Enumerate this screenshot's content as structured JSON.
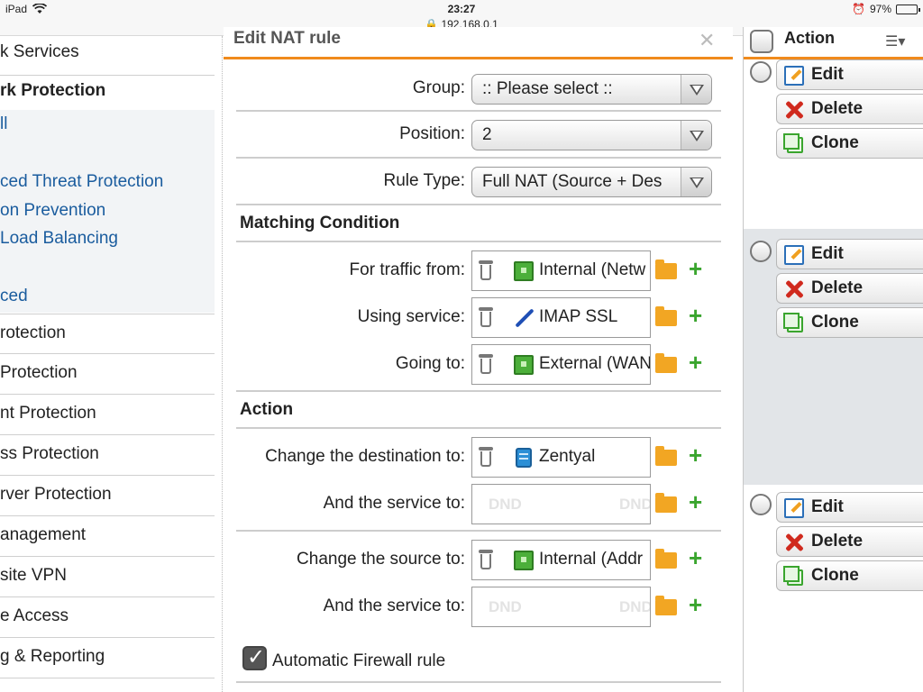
{
  "status_bar": {
    "device": "iPad",
    "time": "23:27",
    "url": "192.168.0.1",
    "battery": "97%",
    "battery_level": 0.97
  },
  "sidebar": {
    "items": [
      {
        "label": "k Services",
        "kind": "plain"
      },
      {
        "label": "rk Protection",
        "kind": "group"
      },
      {
        "label": "ll",
        "kind": "sub"
      },
      {
        "label": "ced Threat Protection",
        "kind": "sub"
      },
      {
        "label": "on Prevention",
        "kind": "sub"
      },
      {
        "label": " Load Balancing",
        "kind": "sub"
      },
      {
        "label": "ced",
        "kind": "sub"
      },
      {
        "label": "rotection",
        "kind": "plain"
      },
      {
        "label": "Protection",
        "kind": "plain"
      },
      {
        "label": "nt Protection",
        "kind": "plain"
      },
      {
        "label": "ss Protection",
        "kind": "plain"
      },
      {
        "label": "rver Protection",
        "kind": "plain"
      },
      {
        "label": "anagement",
        "kind": "plain"
      },
      {
        "label": "site VPN",
        "kind": "plain"
      },
      {
        "label": "e Access",
        "kind": "plain"
      },
      {
        "label": "g & Reporting",
        "kind": "plain"
      }
    ]
  },
  "dialog": {
    "title": "Edit NAT rule",
    "close_icon": "close-icon",
    "fields": {
      "group": {
        "label": "Group:",
        "value": ":: Please select ::"
      },
      "position": {
        "label": "Position:",
        "value": "2"
      },
      "rule_type": {
        "label": "Rule Type:",
        "value": "Full NAT (Source + Des"
      }
    },
    "matching_section": "Matching Condition",
    "traffic_from": {
      "label": "For traffic from:",
      "value": "Internal (Netw",
      "icon": "network-icon"
    },
    "using_service": {
      "label": "Using service:",
      "value": "IMAP SSL",
      "icon": "service-icon"
    },
    "going_to": {
      "label": "Going to:",
      "value": "External (WAN",
      "icon": "network-icon"
    },
    "action_section": "Action",
    "change_destination": {
      "label": "Change the destination to:",
      "value": "Zentyal",
      "icon": "host-icon"
    },
    "dest_service": {
      "label": "And the service to:",
      "dnd_left": "DND",
      "dnd_right": "DND"
    },
    "change_source": {
      "label": "Change the source to:",
      "value": "Internal (Addr",
      "icon": "network-icon"
    },
    "source_service": {
      "label": "And the service to:",
      "dnd_left": "DND",
      "dnd_right": "DND"
    },
    "auto_firewall": {
      "label": "Automatic Firewall rule",
      "checked": true
    }
  },
  "actions_panel": {
    "header": "Action",
    "rows": [
      {
        "edit": "Edit",
        "delete": "Delete",
        "clone": "Clone"
      },
      {
        "edit": "Edit",
        "delete": "Delete",
        "clone": "Clone"
      },
      {
        "edit": "Edit",
        "delete": "Delete",
        "clone": "Clone"
      }
    ]
  },
  "colors": {
    "accent_orange": "#f08a1c",
    "link_blue": "#1a5c9e",
    "add_green": "#3aa52e",
    "folder_orange": "#f2a623"
  }
}
